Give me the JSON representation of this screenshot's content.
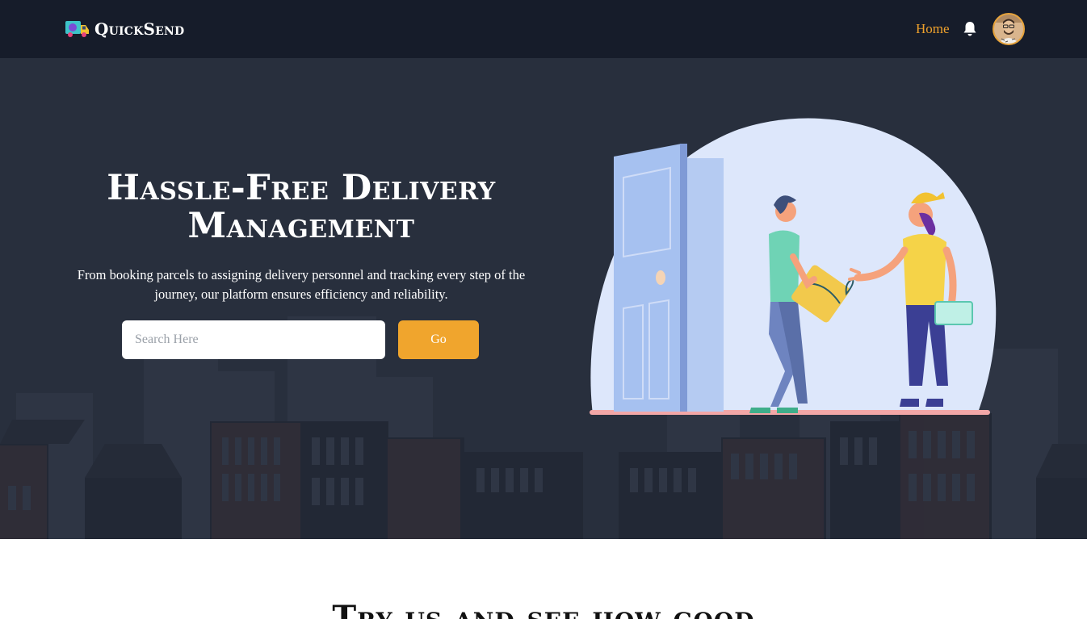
{
  "brand": {
    "name": "QuickSend",
    "logo_icon": "delivery-truck-icon"
  },
  "nav": {
    "home_label": "Home",
    "home_color": "#f0a22c",
    "notification_icon": "bell-icon",
    "avatar_icon": "user-avatar"
  },
  "hero": {
    "title": "Hassle-Free Delivery Management",
    "subtitle": "From booking parcels to assigning delivery personnel and tracking every step of the journey, our platform ensures efficiency and reliability.",
    "search_placeholder": "Search Here",
    "search_value": "",
    "go_label": "Go",
    "accent_color": "#f0a52d",
    "illustration": "parcel-delivery-illustration"
  },
  "section": {
    "title": "Try us and see how good"
  }
}
